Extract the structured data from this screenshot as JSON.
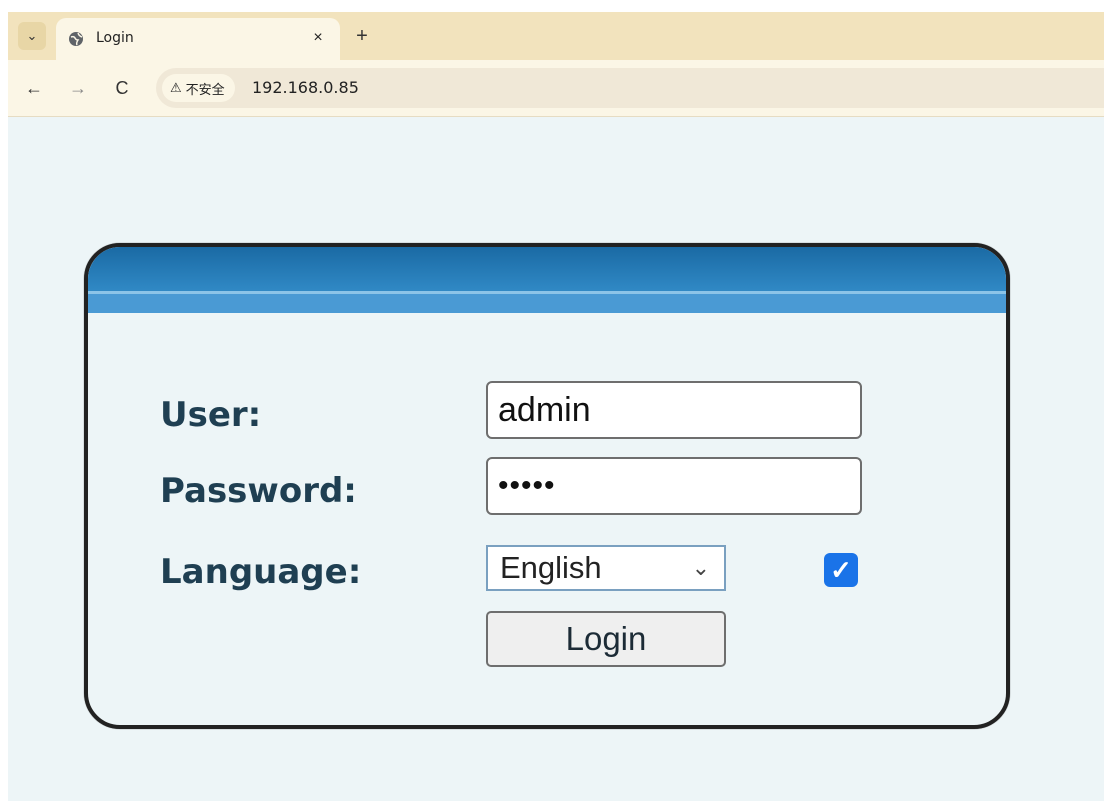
{
  "browser": {
    "tab": {
      "title": "Login",
      "close_glyph": "×"
    },
    "tab_menu_glyph": "⌄",
    "new_tab_glyph": "+",
    "nav": {
      "back_glyph": "←",
      "forward_glyph": "→",
      "reload_glyph": "C"
    },
    "security": {
      "warning_glyph": "⚠",
      "label": "不安全"
    },
    "url": "192.168.0.85"
  },
  "login": {
    "user_label": "User:",
    "password_label": "Password:",
    "language_label": "Language:",
    "user_value": "admin",
    "password_masked": "•••••",
    "language_selected": "English",
    "remember_checked": true,
    "login_button": "Login"
  },
  "colors": {
    "header_blue": "#2e86c2",
    "label_text": "#1f3f52",
    "checkbox_blue": "#1a73e8",
    "page_bg": "#edf5f7"
  }
}
